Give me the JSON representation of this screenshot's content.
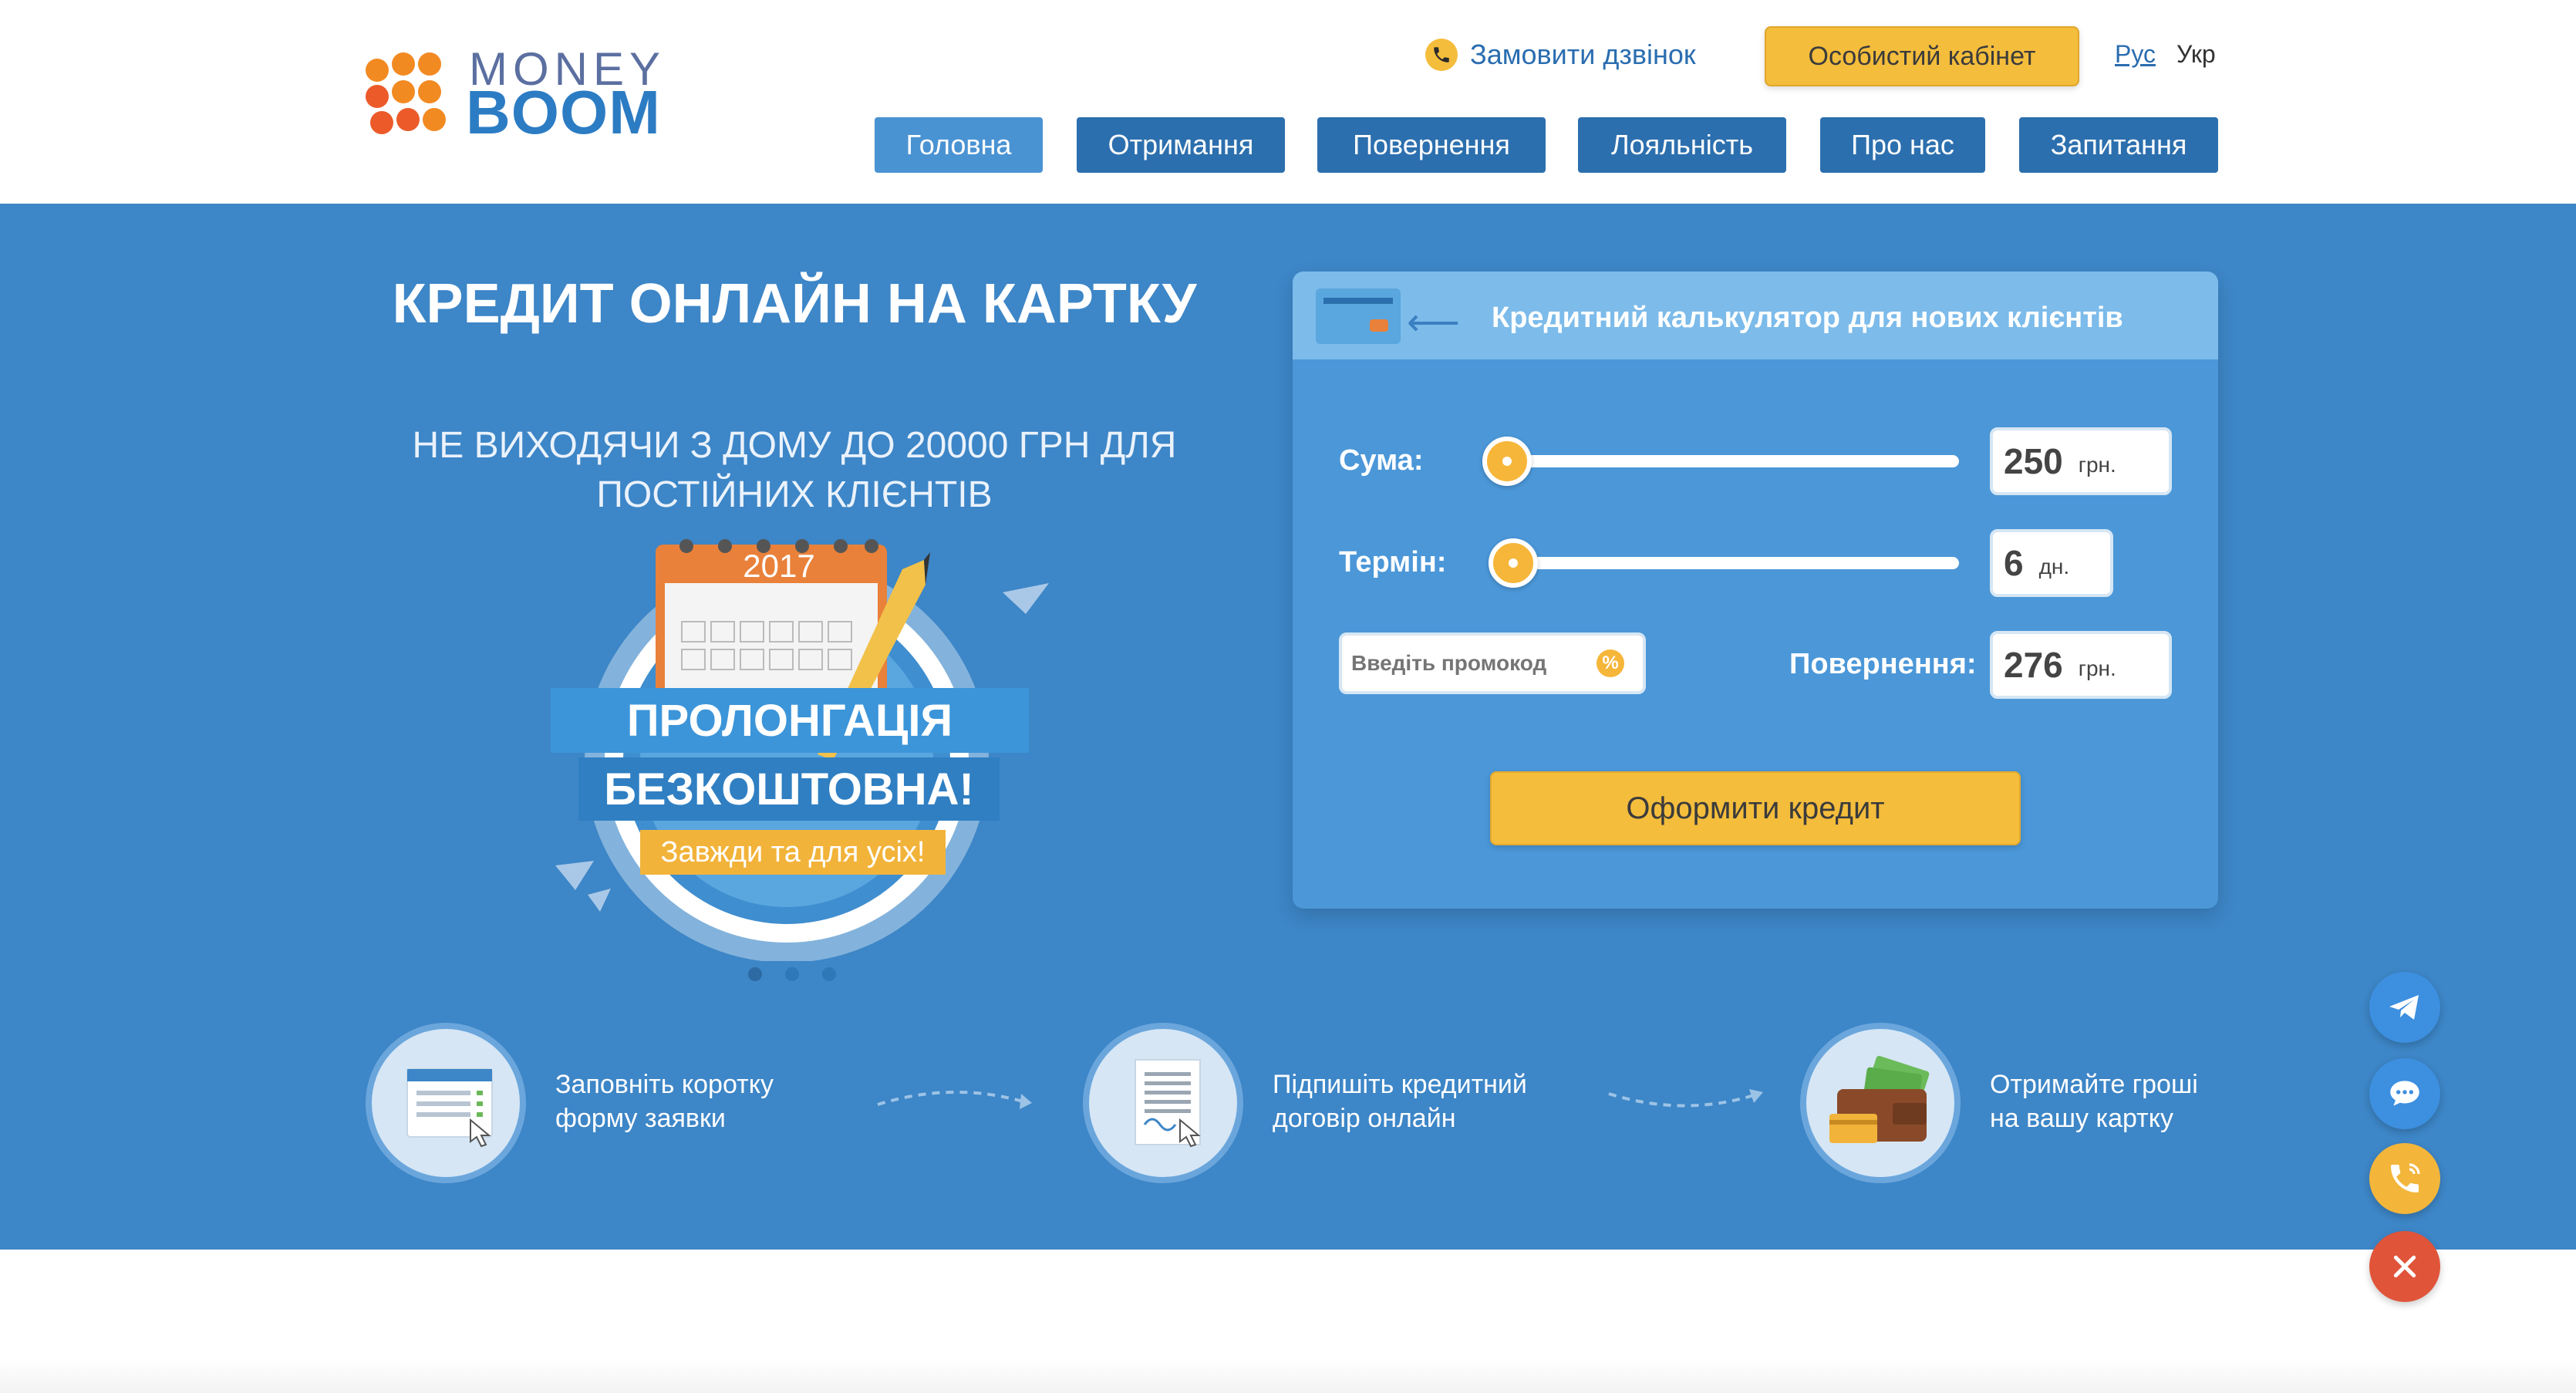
{
  "brand": {
    "line1": "MONEY",
    "line2": "BOOM",
    "dot_colors": [
      "#f28a22",
      "#ec5a2a"
    ]
  },
  "header": {
    "callback_label": "Замовити дзвінок",
    "cabinet_label": "Особистий кабінет",
    "lang_ru": "Рус",
    "lang_uk": "Укр",
    "nav": [
      "Головна",
      "Отримання",
      "Повернення",
      "Лояльність",
      "Про нас",
      "Запитання"
    ],
    "active_nav": "Головна"
  },
  "hero": {
    "title": "КРЕДИТ ОНЛАЙН НА КАРТКУ",
    "subtitle": "НЕ ВИХОДЯЧИ З ДОМУ ДО 20000 ГРН ДЛЯ ПОСТІЙНИХ КЛІЄНТІВ",
    "banner": {
      "year": "2017",
      "line1": "ПРОЛОНГАЦІЯ",
      "line2": "БЕЗКОШТОВНА!",
      "ribbon": "Завжди та для усіх!"
    },
    "slides_count": 3,
    "active_slide": 1
  },
  "calculator": {
    "title": "Кредитний калькулятор для нових клієнтів",
    "amount_label": "Сума:",
    "amount_value": "250",
    "amount_unit": "грн.",
    "amount_fraction": 0.0,
    "term_label": "Термін:",
    "term_value": "6",
    "term_unit": "дн.",
    "term_fraction": 0.02,
    "promo_placeholder": "Введіть промокод",
    "promo_icon": "%",
    "return_label": "Повернення:",
    "return_value": "276",
    "return_unit": "грн.",
    "submit_label": "Оформити кредит"
  },
  "steps": [
    {
      "icon": "form-icon",
      "text_line1": "Заповніть коротку",
      "text_line2": "форму заявки"
    },
    {
      "icon": "contract-icon",
      "text_line1": "Підпишіть кредитний",
      "text_line2": "договір онлайн"
    },
    {
      "icon": "wallet-icon",
      "text_line1": "Отримайте гроші",
      "text_line2": "на вашу картку"
    }
  ],
  "floating": {
    "telegram_icon": "telegram-icon",
    "chat_icon": "chat-icon",
    "call_icon": "phone-call-icon",
    "close_icon": "close-icon"
  },
  "colors": {
    "primary_blue": "#3d86c7",
    "nav_blue": "#2c6fae",
    "accent_yellow": "#f4bd3c",
    "close_red": "#e0543a"
  }
}
